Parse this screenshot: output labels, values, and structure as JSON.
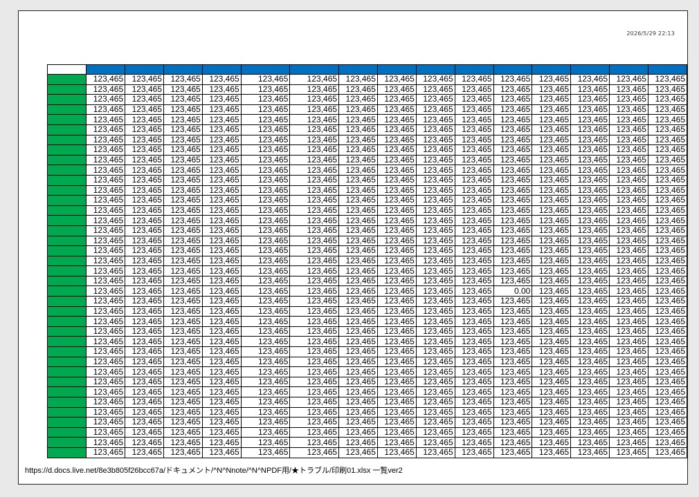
{
  "page": {
    "timestamp": "2026/5/29  22:13",
    "footer_path": "https://d.docs.live.net/8e3b805f26bcc67a/ドキュメント/^N^Nnote/^N^NPDF用/★トラブル/印刷01.xlsx 一覧ver2"
  },
  "colors": {
    "header_fill": "#0070c0",
    "row_header_fill": "#00a84f",
    "cell_fill": "#ffffff",
    "grid": "#000000"
  },
  "table": {
    "row_count": 38,
    "column_count": 15,
    "default_value": "123,465",
    "exceptions": [
      {
        "row": 21,
        "col": 10,
        "value": "0.00"
      }
    ]
  }
}
